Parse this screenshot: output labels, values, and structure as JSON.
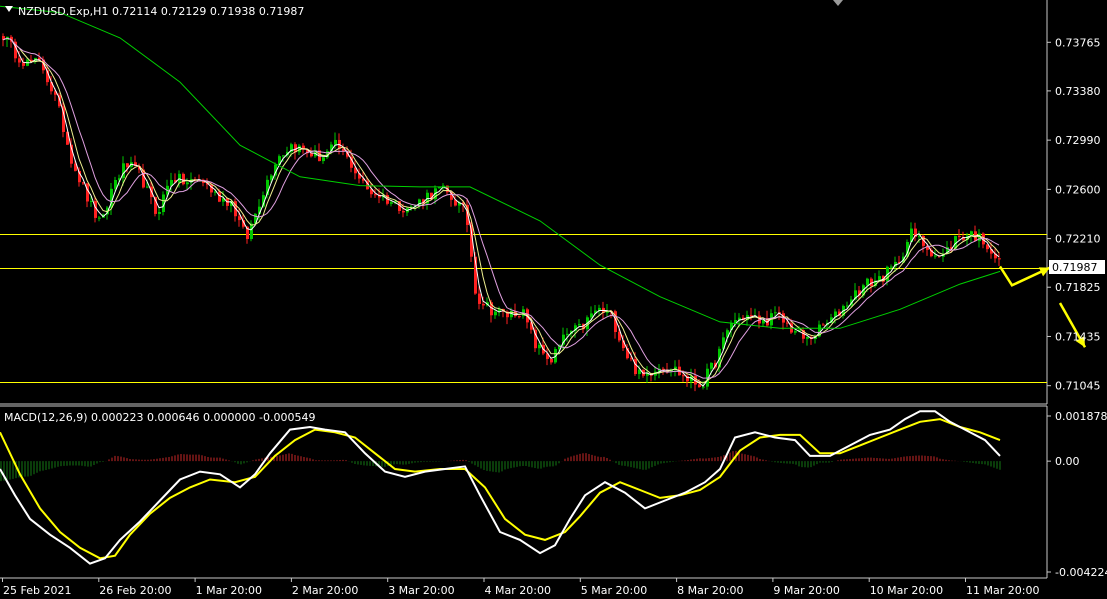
{
  "header": {
    "symbol_line": "NZDUSD.Exp,H1  0.72114 0.72129 0.71938 0.71987",
    "macd_line": "MACD(12,26,9) 0.000223 0.000646 0.000000 -0.000549",
    "current_price": "0.71987"
  },
  "colors": {
    "background": "#000000",
    "bull": "#00c800",
    "bear": "#ff2020",
    "ma_fast": "#ffffff",
    "ma_mid": "#f0f090",
    "ma_pink": "#e0a0e0",
    "ma_slow": "#00d000",
    "level_line": "#ffff00",
    "arrow": "#ffff00",
    "macd_main": "#ffffff",
    "macd_signal": "#ffff00",
    "hist_pos": "#c82828",
    "hist_neg": "#147814"
  },
  "chart_data": [
    {
      "type": "candlestick",
      "panel": "price",
      "y_ticks": [
        "0.73765",
        "0.73380",
        "0.72990",
        "0.72600",
        "0.72210",
        "0.71825",
        "0.71435",
        "0.71045"
      ],
      "ylim": [
        0.709,
        0.741
      ],
      "x_tick_labels": [
        "25 Feb 2021",
        "26 Feb 20:00",
        "1 Mar 20:00",
        "2 Mar 20:00",
        "3 Mar 20:00",
        "4 Mar 20:00",
        "5 Mar 20:00",
        "8 Mar 20:00",
        "9 Mar 20:00",
        "10 Mar 20:00",
        "11 Mar 20:00"
      ],
      "horizontal_levels": [
        0.72247,
        0.71975,
        0.71073
      ],
      "close_path": [
        [
          0,
          0.7385
        ],
        [
          12,
          0.737
        ],
        [
          25,
          0.736
        ],
        [
          40,
          0.736
        ],
        [
          55,
          0.733
        ],
        [
          70,
          0.7285
        ],
        [
          85,
          0.7255
        ],
        [
          100,
          0.723
        ],
        [
          112,
          0.7265
        ],
        [
          125,
          0.728
        ],
        [
          140,
          0.727
        ],
        [
          155,
          0.724
        ],
        [
          170,
          0.727
        ],
        [
          185,
          0.7265
        ],
        [
          200,
          0.7268
        ],
        [
          215,
          0.7255
        ],
        [
          230,
          0.725
        ],
        [
          245,
          0.722
        ],
        [
          260,
          0.7255
        ],
        [
          275,
          0.7285
        ],
        [
          290,
          0.7295
        ],
        [
          305,
          0.729
        ],
        [
          320,
          0.7285
        ],
        [
          335,
          0.7295
        ],
        [
          350,
          0.728
        ],
        [
          365,
          0.726
        ],
        [
          380,
          0.7255
        ],
        [
          395,
          0.7248
        ],
        [
          410,
          0.7245
        ],
        [
          425,
          0.7255
        ],
        [
          440,
          0.726
        ],
        [
          455,
          0.725
        ],
        [
          465,
          0.724
        ],
        [
          475,
          0.7175
        ],
        [
          490,
          0.7165
        ],
        [
          505,
          0.716
        ],
        [
          520,
          0.7165
        ],
        [
          535,
          0.7135
        ],
        [
          550,
          0.7125
        ],
        [
          565,
          0.7145
        ],
        [
          580,
          0.715
        ],
        [
          595,
          0.7165
        ],
        [
          610,
          0.716
        ],
        [
          625,
          0.713
        ],
        [
          640,
          0.711
        ],
        [
          655,
          0.712
        ],
        [
          670,
          0.712
        ],
        [
          685,
          0.711
        ],
        [
          700,
          0.7105
        ],
        [
          715,
          0.7125
        ],
        [
          730,
          0.7155
        ],
        [
          745,
          0.716
        ],
        [
          760,
          0.7155
        ],
        [
          775,
          0.716
        ],
        [
          790,
          0.715
        ],
        [
          805,
          0.714
        ],
        [
          820,
          0.715
        ],
        [
          835,
          0.716
        ],
        [
          850,
          0.7175
        ],
        [
          865,
          0.7185
        ],
        [
          880,
          0.719
        ],
        [
          895,
          0.72
        ],
        [
          910,
          0.7225
        ],
        [
          925,
          0.7215
        ],
        [
          940,
          0.7205
        ],
        [
          955,
          0.7222
        ],
        [
          970,
          0.7225
        ],
        [
          985,
          0.7218
        ],
        [
          1000,
          0.7199
        ]
      ],
      "ma_slow_path": [
        [
          0,
          0.7405
        ],
        [
          60,
          0.74
        ],
        [
          120,
          0.738
        ],
        [
          180,
          0.7345
        ],
        [
          240,
          0.7295
        ],
        [
          300,
          0.727
        ],
        [
          360,
          0.7263
        ],
        [
          420,
          0.7262
        ],
        [
          470,
          0.7262
        ],
        [
          540,
          0.7235
        ],
        [
          600,
          0.72
        ],
        [
          660,
          0.7175
        ],
        [
          720,
          0.7155
        ],
        [
          780,
          0.715
        ],
        [
          840,
          0.715
        ],
        [
          900,
          0.7165
        ],
        [
          960,
          0.7185
        ],
        [
          1000,
          0.7195
        ]
      ],
      "forecast_arrows": [
        [
          [
            1000,
            0.7199
          ],
          [
            1012,
            0.7184
          ],
          [
            1050,
            0.7198
          ]
        ],
        [
          [
            1060,
            0.717
          ],
          [
            1085,
            0.7135
          ]
        ]
      ]
    },
    {
      "type": "macd",
      "panel": "indicator",
      "y_ticks": [
        "0.001878",
        "0.00",
        "-0.004224"
      ],
      "ylim": [
        -0.00445,
        0.0021
      ],
      "main_path": [
        [
          0,
          -0.0003
        ],
        [
          15,
          -0.0013
        ],
        [
          30,
          -0.0022
        ],
        [
          50,
          -0.0028
        ],
        [
          70,
          -0.0033
        ],
        [
          90,
          -0.0039
        ],
        [
          105,
          -0.0037
        ],
        [
          120,
          -0.003
        ],
        [
          140,
          -0.0023
        ],
        [
          160,
          -0.0015
        ],
        [
          180,
          -0.0007
        ],
        [
          200,
          -0.0004
        ],
        [
          220,
          -0.0005
        ],
        [
          240,
          -0.001
        ],
        [
          255,
          -0.0005
        ],
        [
          270,
          0.0003
        ],
        [
          290,
          0.0012
        ],
        [
          310,
          0.0013
        ],
        [
          325,
          0.0012
        ],
        [
          345,
          0.0011
        ],
        [
          365,
          0.0003
        ],
        [
          385,
          -0.0004
        ],
        [
          405,
          -0.0006
        ],
        [
          425,
          -0.0004
        ],
        [
          445,
          -0.0003
        ],
        [
          465,
          -0.0002
        ],
        [
          480,
          -0.0013
        ],
        [
          500,
          -0.0027
        ],
        [
          520,
          -0.003
        ],
        [
          540,
          -0.0035
        ],
        [
          555,
          -0.0032
        ],
        [
          570,
          -0.0022
        ],
        [
          585,
          -0.0013
        ],
        [
          605,
          -0.0008
        ],
        [
          625,
          -0.0012
        ],
        [
          645,
          -0.0018
        ],
        [
          665,
          -0.0015
        ],
        [
          685,
          -0.0012
        ],
        [
          705,
          -0.0008
        ],
        [
          720,
          -0.0003
        ],
        [
          735,
          0.0009
        ],
        [
          755,
          0.0011
        ],
        [
          775,
          0.0009
        ],
        [
          795,
          0.0008
        ],
        [
          810,
          0.0002
        ],
        [
          830,
          0.0002
        ],
        [
          850,
          0.0006
        ],
        [
          870,
          0.001
        ],
        [
          890,
          0.0012
        ],
        [
          905,
          0.0016
        ],
        [
          920,
          0.0019
        ],
        [
          935,
          0.0019
        ],
        [
          950,
          0.0015
        ],
        [
          965,
          0.0012
        ],
        [
          985,
          0.0008
        ],
        [
          1000,
          0.0002
        ]
      ],
      "signal_path": [
        [
          0,
          0.0011
        ],
        [
          20,
          -0.0005
        ],
        [
          40,
          -0.0018
        ],
        [
          60,
          -0.0027
        ],
        [
          80,
          -0.0033
        ],
        [
          100,
          -0.0037
        ],
        [
          115,
          -0.0036
        ],
        [
          130,
          -0.0028
        ],
        [
          150,
          -0.002
        ],
        [
          170,
          -0.0014
        ],
        [
          190,
          -0.001
        ],
        [
          210,
          -0.0007
        ],
        [
          235,
          -0.0008
        ],
        [
          255,
          -0.0006
        ],
        [
          275,
          0.0002
        ],
        [
          295,
          0.0008
        ],
        [
          315,
          0.0012
        ],
        [
          335,
          0.0011
        ],
        [
          355,
          0.0009
        ],
        [
          375,
          0.0003
        ],
        [
          395,
          -0.0003
        ],
        [
          415,
          -0.0004
        ],
        [
          440,
          -0.0003
        ],
        [
          465,
          -0.0003
        ],
        [
          485,
          -0.001
        ],
        [
          505,
          -0.0022
        ],
        [
          525,
          -0.0028
        ],
        [
          545,
          -0.003
        ],
        [
          565,
          -0.0027
        ],
        [
          580,
          -0.0021
        ],
        [
          600,
          -0.0012
        ],
        [
          620,
          -0.0008
        ],
        [
          640,
          -0.0011
        ],
        [
          660,
          -0.0014
        ],
        [
          680,
          -0.0013
        ],
        [
          700,
          -0.0011
        ],
        [
          720,
          -0.0006
        ],
        [
          740,
          0.0004
        ],
        [
          760,
          0.0009
        ],
        [
          780,
          0.001
        ],
        [
          800,
          0.001
        ],
        [
          820,
          0.0003
        ],
        [
          840,
          0.0003
        ],
        [
          860,
          0.0006
        ],
        [
          880,
          0.0009
        ],
        [
          900,
          0.0012
        ],
        [
          920,
          0.0015
        ],
        [
          940,
          0.0016
        ],
        [
          960,
          0.0013
        ],
        [
          980,
          0.0011
        ],
        [
          1000,
          0.0008
        ]
      ]
    }
  ]
}
